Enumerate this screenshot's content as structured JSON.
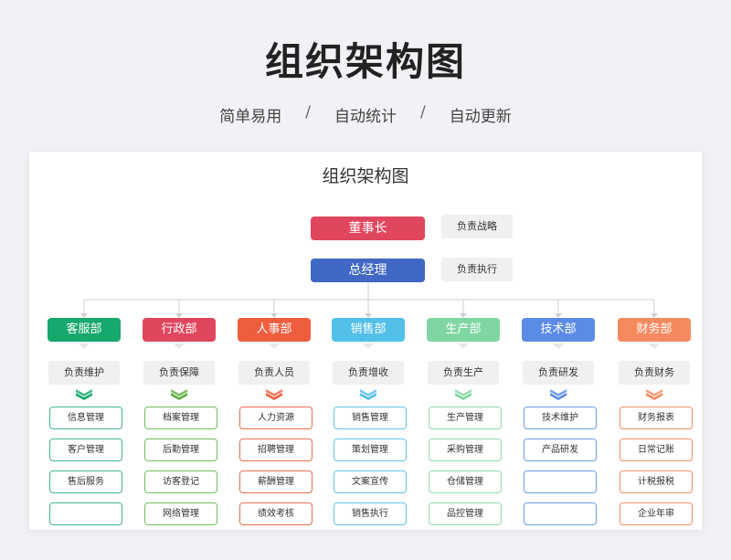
{
  "page": {
    "title": "组织架构图",
    "subtitle": [
      "简单易用",
      "自动统计",
      "自动更新"
    ],
    "separator": "/"
  },
  "sheet": {
    "title": "组织架构图",
    "top": [
      {
        "label": "董事长",
        "duty": "负责战略",
        "color": "#e0475e"
      },
      {
        "label": "总经理",
        "duty": "负责执行",
        "color": "#4068c4"
      }
    ],
    "departments": [
      {
        "name": "客服部",
        "duty": "负责维护",
        "color": "#17a86d",
        "tasks": [
          "信息管理",
          "客户管理",
          "售后服务",
          ""
        ]
      },
      {
        "name": "行政部",
        "duty": "负责保障",
        "color": "#e0475e",
        "tasks": [
          "档案管理",
          "后勤管理",
          "访客登记",
          "网络管理"
        ]
      },
      {
        "name": "人事部",
        "duty": "负责人员",
        "color": "#ee5e3e",
        "tasks": [
          "人力资源",
          "招聘管理",
          "薪酬管理",
          "绩效考核"
        ]
      },
      {
        "name": "销售部",
        "duty": "负责增收",
        "color": "#51bfe8",
        "tasks": [
          "销售管理",
          "策划管理",
          "文案宣传",
          "销售执行"
        ]
      },
      {
        "name": "生产部",
        "duty": "负责生产",
        "color": "#7fd6a2",
        "tasks": [
          "生产管理",
          "采购管理",
          "仓储管理",
          "品控管理"
        ]
      },
      {
        "name": "技术部",
        "duty": "负责研发",
        "color": "#5b8be6",
        "tasks": [
          "技术维护",
          "产品研发",
          "",
          ""
        ]
      },
      {
        "name": "财务部",
        "duty": "负责财务",
        "color": "#f58a5f",
        "tasks": [
          "财务报表",
          "日常记账",
          "计税报税",
          "企业年审"
        ]
      }
    ],
    "chevron_colors": [
      "#17a86d",
      "#5aae3e",
      "#ee5e3e",
      "#51bfe8",
      "#7fd6a2",
      "#5b8be6",
      "#f58a5f"
    ],
    "task_border_colors": [
      "#3fb88a",
      "#6fbf5b",
      "#ee6e52",
      "#63c4ea",
      "#8fdcb0",
      "#6e98e8",
      "#f28e6a"
    ]
  }
}
